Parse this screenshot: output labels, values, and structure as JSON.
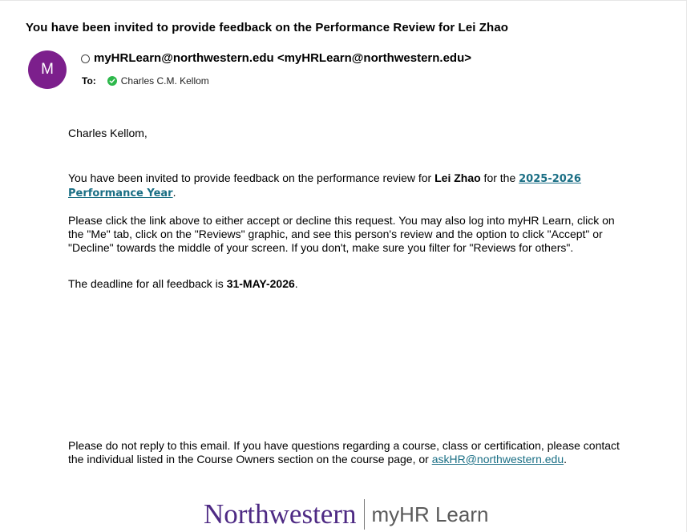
{
  "email": {
    "subject": "You have been invited to provide feedback on the Performance Review for Lei Zhao",
    "avatar_letter": "M",
    "avatar_color": "#7c1f8c",
    "from": "myHRLearn@northwestern.edu <myHRLearn@northwestern.edu>",
    "to_label": "To:",
    "recipient": "Charles C.M. Kellom",
    "recipient_status_icon": "check-circle-icon"
  },
  "body": {
    "greeting": "Charles Kellom,",
    "p1_prefix": "You have been invited to provide feedback on the performance review for ",
    "p1_name": "Lei Zhao",
    "p1_mid": " for the ",
    "p1_link": "2025-2026 Performance Year",
    "p1_suffix": ".",
    "p2": "Please click the link above to either accept or decline this request. You may also log into myHR Learn, click on the \"Me\" tab, click on the \"Reviews\" graphic, and see this person's review and the option to click \"Accept\" or \"Decline\" towards the middle of your screen. If you don't, make sure you filter for \"Reviews for others\".",
    "p3_prefix": "The deadline for all feedback is ",
    "p3_date": "31-MAY-2026",
    "p3_suffix": ".",
    "p4_text": "Please do not reply to this email. If you have questions regarding a course, class or certification, please contact the individual listed in the Course Owners section on the course page, or ",
    "p4_email": "askHR@northwestern.edu",
    "p4_suffix": "."
  },
  "footer": {
    "logo_left": "Northwestern",
    "logo_right": "myHR Learn",
    "brand_color": "#4e2a84"
  },
  "colors": {
    "link": "#1b6f85",
    "status_green": "#2db84b"
  }
}
